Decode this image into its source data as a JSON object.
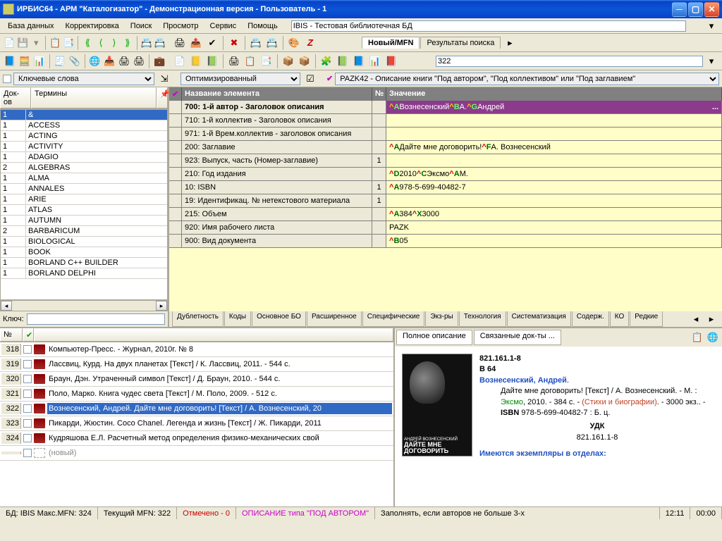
{
  "title": "ИРБИС64 - АРМ \"Каталогизатор\" - Демонстрационная версия - Пользователь - 1",
  "menu": [
    "База данных",
    "Корректировка",
    "Поиск",
    "Просмотр",
    "Сервис",
    "Помощь"
  ],
  "db_selector": "IBIS - Тестовая библиотечная БД",
  "left_select": "Ключевые слова",
  "right_select1": "Оптимизированный",
  "right_select2": "PAZK42 - Описание книги \"Под автором\", \"Под коллективом\" или \"Под заглавием\"",
  "tab_new": "Новый/MFN",
  "tab_results": "Результаты поиска",
  "mfn_value": "322",
  "term_hdr1": "Док-ов",
  "term_hdr2": "Термины",
  "terms": [
    {
      "n": "1",
      "t": "&",
      "sel": true
    },
    {
      "n": "1",
      "t": "ACCESS"
    },
    {
      "n": "1",
      "t": "ACTING"
    },
    {
      "n": "1",
      "t": "ACTIVITY"
    },
    {
      "n": "1",
      "t": "ADAGIO"
    },
    {
      "n": "2",
      "t": "ALGEBRAS"
    },
    {
      "n": "1",
      "t": "ALMA"
    },
    {
      "n": "1",
      "t": "ANNALES"
    },
    {
      "n": "1",
      "t": "ARIE"
    },
    {
      "n": "1",
      "t": "ATLAS"
    },
    {
      "n": "1",
      "t": "AUTUMN"
    },
    {
      "n": "2",
      "t": "BARBARICUM"
    },
    {
      "n": "1",
      "t": "BIOLOGICAL"
    },
    {
      "n": "1",
      "t": "BOOK"
    },
    {
      "n": "1",
      "t": "BORLAND C++ BUILDER"
    },
    {
      "n": "1",
      "t": "BORLAND DELPHI"
    }
  ],
  "key_label": "Ключ:",
  "data_hdr_name": "Название элемента",
  "data_hdr_no": "№",
  "data_hdr_val": "Значение",
  "fields": [
    {
      "name": "700: 1-й  автор - Заголовок описания",
      "no": "",
      "val": "^AВознесенский^BА.^GАндрей",
      "hi": true,
      "purple": true
    },
    {
      "name": "710: 1-й коллектив - Заголовок описания",
      "no": "",
      "val": ""
    },
    {
      "name": "971: 1-й Врем.коллектив - заголовок описания",
      "no": "",
      "val": ""
    },
    {
      "name": "200: Заглавие",
      "no": "",
      "val": "^AДайте мне договорить!^FА. Вознесенский"
    },
    {
      "name": "923: Выпуск, часть (Номер-заглавие)",
      "no": "1",
      "val": ""
    },
    {
      "name": "210: Год издания",
      "no": "",
      "val": "^D2010^CЭксмо^AМ."
    },
    {
      "name": "10: ISBN",
      "no": "1",
      "val": "^A978-5-699-40482-7"
    },
    {
      "name": "19: Идентификац. № нетекстового материала",
      "no": "1",
      "val": ""
    },
    {
      "name": "215: Объем",
      "no": "",
      "val": "^A384^X3000"
    },
    {
      "name": "920: Имя рабочего листа",
      "no": "",
      "val": "PAZK"
    },
    {
      "name": "900: Вид документа",
      "no": "",
      "val": "^B05"
    }
  ],
  "bottom_tabs": [
    "Дублетность",
    "Коды",
    "Основное БО",
    "Расширенное",
    "Специфические",
    "Экз-ры",
    "Технология",
    "Систематизация",
    "Содерж.",
    "КО",
    "Редкие"
  ],
  "records_hdr_no": "№",
  "records": [
    {
      "n": "318",
      "t": "Компьютер-Пресс. - Журнал, 2010г. № 8"
    },
    {
      "n": "319",
      "t": "Лассвиц, Курд. На двух планетах [Текст] / К. Лассвиц, 2011. - 544 с."
    },
    {
      "n": "320",
      "t": "Браун, Дэн. Утраченный символ [Текст] / Д. Браун, 2010. - 544 с."
    },
    {
      "n": "321",
      "t": "Поло, Марко. Книга чудес света [Текст] / М. Поло, 2009. - 512 с."
    },
    {
      "n": "322",
      "t": "Вознесенский, Андрей. Дайте мне договорить! [Текст] / А. Вознесенский, 20",
      "sel": true
    },
    {
      "n": "323",
      "t": "Пикарди, Жюстин. Coco Chanel. Легенда и жизнь [Текст] / Ж. Пикарди, 2011"
    },
    {
      "n": "324",
      "t": "Кудряшова Е.Л. Расчетный метод определения физико-механических свой"
    },
    {
      "n": "",
      "t": "(новый)",
      "new": true
    }
  ],
  "desc_tab1": "Полное описание",
  "desc_tab2": "Связанные док-ты ...",
  "desc": {
    "udc": "821.161.1-8",
    "shelf": "В 64",
    "author": "Вознесенский, Андрей",
    "title": "Дайте мне договорить! [Текст]",
    "resp": "А. Вознесенский",
    "place": "М.",
    "publisher": "Эксмо",
    "year": "2010",
    "pages": "384 с",
    "series": "(Стихи и биографии)",
    "print": "3000 экз.",
    "isbn_lbl": "ISBN",
    "isbn": "978-5-699-40482-7",
    "price": "Б. ц.",
    "udc_lbl": "УДК",
    "udc2": "821.161.1-8",
    "copies_hdr": "Имеются экземпляры в отделах:"
  },
  "book_cover_author": "АНДРЕЙ ВОЗНЕСЕНСКИЙ",
  "book_cover_title": "ДАЙТЕ МНЕ ДОГОВОРИТЬ",
  "status": {
    "db": "БД: IBIS Макс.MFN: 324",
    "cur": "Текущий MFN: 322",
    "marked": "Отмечено - 0",
    "type": "ОПИСАНИЕ типа \"ПОД АВТОРОМ\"",
    "hint": "Заполнять, если авторов не больше 3-х",
    "time": "12:11",
    "extra": "00:00"
  }
}
